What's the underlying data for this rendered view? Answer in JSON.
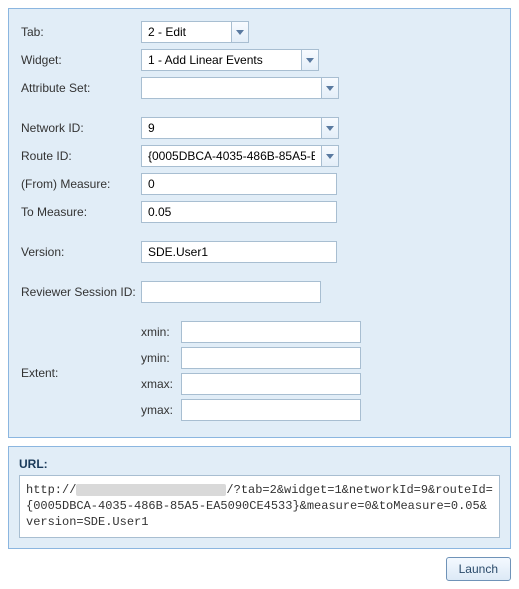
{
  "form": {
    "tab": {
      "label": "Tab:",
      "value": "2 - Edit"
    },
    "widget": {
      "label": "Widget:",
      "value": "1 - Add Linear Events"
    },
    "attrSet": {
      "label": "Attribute Set:",
      "value": ""
    },
    "networkId": {
      "label": "Network ID:",
      "value": "9"
    },
    "routeId": {
      "label": "Route ID:",
      "value": "{0005DBCA-4035-486B-85A5-E"
    },
    "fromMeasure": {
      "label": "(From) Measure:",
      "value": "0"
    },
    "toMeasure": {
      "label": "To Measure:",
      "value": "0.05"
    },
    "version": {
      "label": "Version:",
      "value": "SDE.User1"
    },
    "sessionId": {
      "label": "Reviewer Session ID:",
      "value": ""
    },
    "extent": {
      "label": "Extent:",
      "xmin": {
        "label": "xmin:",
        "value": ""
      },
      "ymin": {
        "label": "ymin:",
        "value": ""
      },
      "xmax": {
        "label": "xmax:",
        "value": ""
      },
      "ymax": {
        "label": "ymax:",
        "value": ""
      }
    }
  },
  "url": {
    "title": "URL:",
    "prefix": "http://",
    "suffix": "/?tab=2&widget=1&networkId=9&routeId={0005DBCA-4035-486B-85A5-EA5090CE4533}&measure=0&toMeasure=0.05&version=SDE.User1"
  },
  "launchLabel": "Launch"
}
